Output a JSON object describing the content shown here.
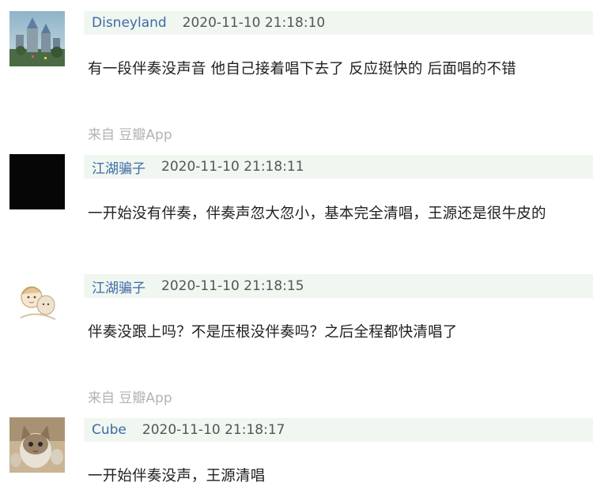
{
  "comments": [
    {
      "username": "Disneyland",
      "timestamp": "2020-11-10 21:18:10",
      "text": "有一段伴奏没声音 他自己接着唱下去了 反应挺快的 后面唱的不错",
      "source": "来自 豆瓣App",
      "avatar": "castle-photo-avatar"
    },
    {
      "username": "江湖骗子",
      "timestamp": "2020-11-10 21:18:11",
      "text": "一开始没有伴奏，伴奏声忽大忽小，基本完全清唱，王源还是很牛皮的",
      "avatar": "black-square-avatar"
    },
    {
      "username": "江湖骗子",
      "timestamp": "2020-11-10 21:18:15",
      "text": "伴奏没跟上吗？不是压根没伴奏吗？之后全程都快清唱了",
      "source": "来自 豆瓣App",
      "avatar": "cartoon-drawing-avatar"
    },
    {
      "username": "Cube",
      "timestamp": "2020-11-10 21:18:17",
      "text": "一开始伴奏没声，王源清唱",
      "avatar": "cat-photo-avatar"
    }
  ],
  "colors": {
    "username": "#3d6aa6",
    "meta_bar_bg": "#f0f6f0",
    "source_text": "#b3b3b3"
  }
}
